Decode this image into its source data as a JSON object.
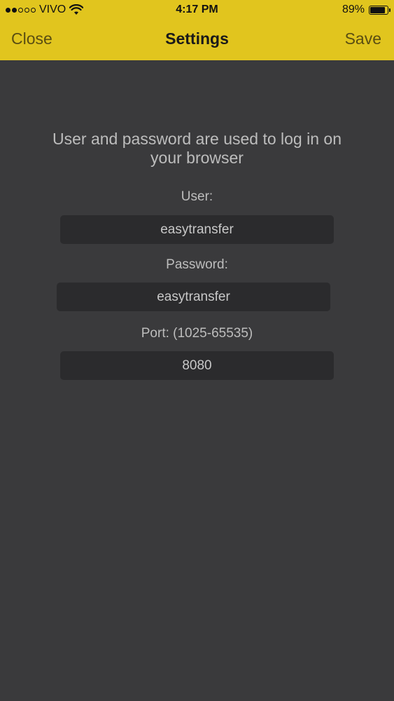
{
  "status_bar": {
    "carrier": "VIVO",
    "time": "4:17 PM",
    "battery_percent_label": "89%",
    "battery_level": 0.89,
    "signal_bars_filled": 2,
    "signal_bars_total": 5
  },
  "nav": {
    "close_label": "Close",
    "title": "Settings",
    "save_label": "Save"
  },
  "description": "User and password are used to log in on your browser",
  "fields": {
    "user": {
      "label": "User:",
      "value": "easytransfer"
    },
    "password": {
      "label": "Password:",
      "value": "easytransfer"
    },
    "port": {
      "label": "Port: (1025-65535)",
      "value": "8080"
    }
  },
  "colors": {
    "header_bg": "#e1c51e",
    "page_bg": "#3a3a3c",
    "input_bg": "#2b2b2d"
  }
}
